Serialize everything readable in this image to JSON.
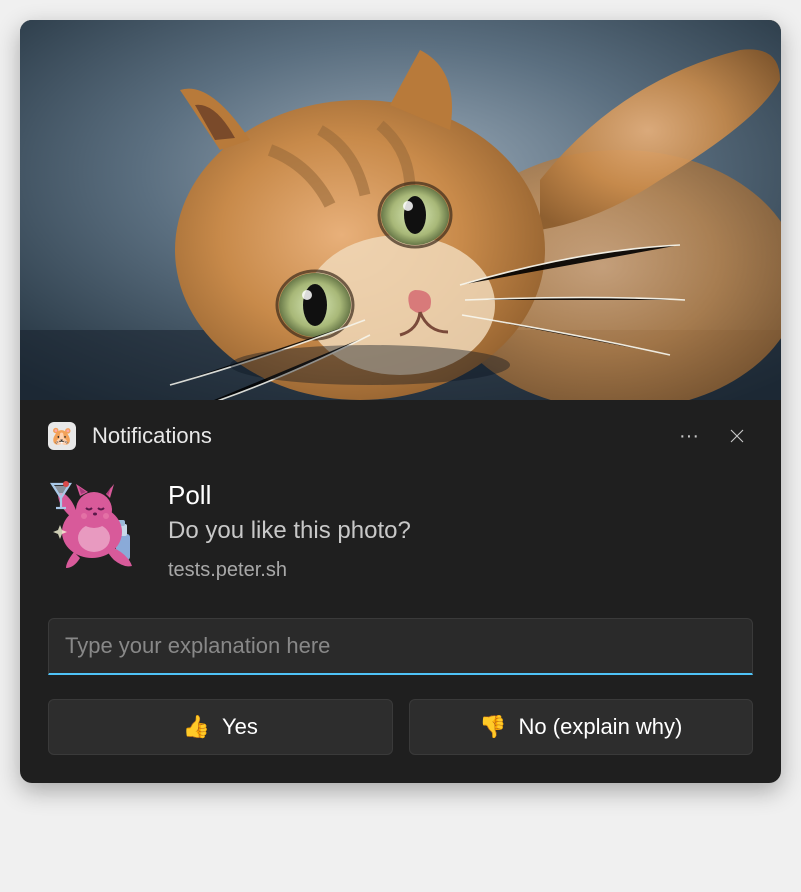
{
  "header": {
    "app_name": "Notifications",
    "app_icon": "hamster-icon"
  },
  "content": {
    "title": "Poll",
    "body": "Do you like this photo?",
    "source": "tests.peter.sh",
    "icon": "pink-cat-cocktail-icon"
  },
  "input": {
    "placeholder": "Type your explanation here",
    "value": ""
  },
  "buttons": {
    "yes": {
      "emoji": "👍",
      "label": "Yes"
    },
    "no": {
      "emoji": "👎",
      "label": "No (explain why)"
    }
  }
}
